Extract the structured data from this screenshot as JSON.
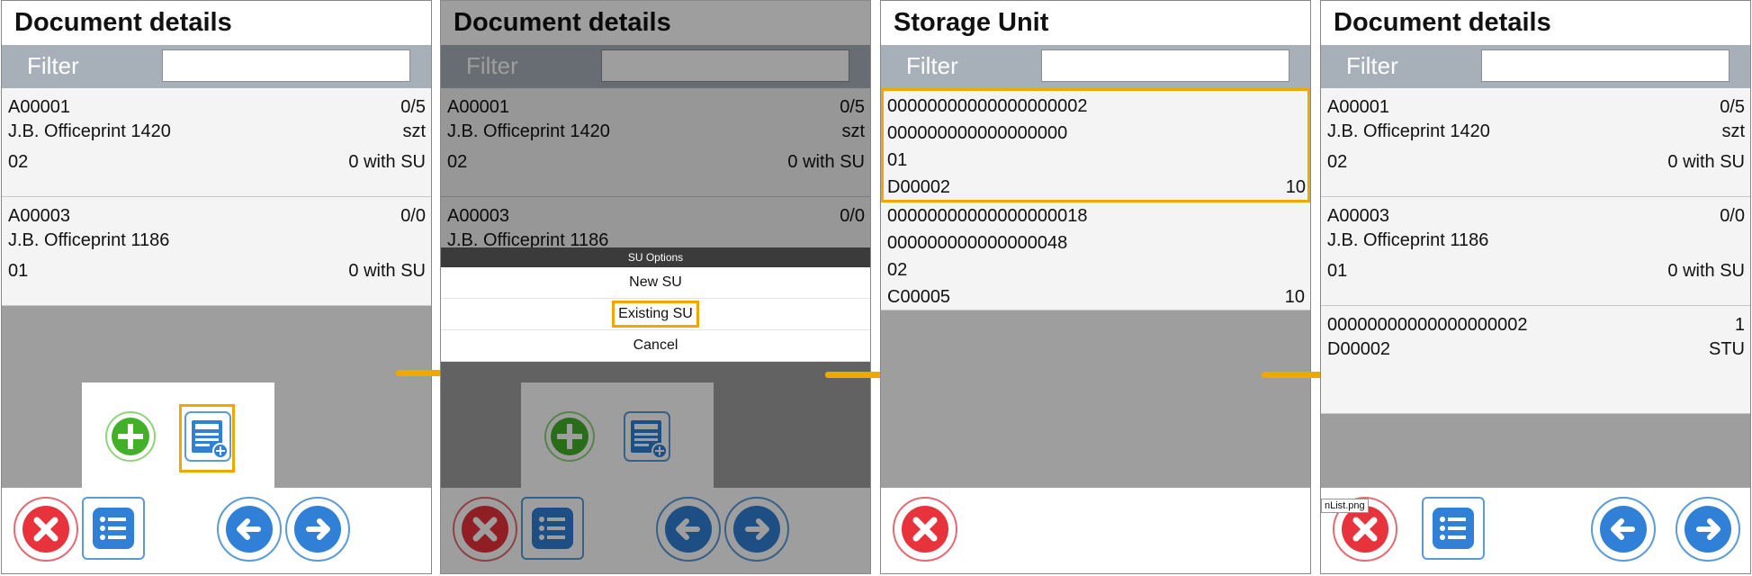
{
  "screens": [
    {
      "title": "Document details",
      "filter_label": "Filter",
      "items": [
        {
          "code": "A00001",
          "qty": "0/5",
          "name": "J.B. Officeprint 1420",
          "unit": "szt",
          "loc": "02",
          "su": "0 with SU"
        },
        {
          "code": "A00003",
          "qty": "0/0",
          "name": "J.B. Officeprint 1186",
          "unit": "",
          "loc": "01",
          "su": "0 with SU"
        }
      ]
    },
    {
      "title": "Document details",
      "filter_label": "Filter",
      "items": [
        {
          "code": "A00001",
          "qty": "0/5",
          "name": "J.B. Officeprint 1420",
          "unit": "szt",
          "loc": "02",
          "su": "0 with SU"
        },
        {
          "code": "A00003",
          "qty": "0/0",
          "name": "J.B. Officeprint 1186"
        }
      ],
      "menu": {
        "title": "SU Options",
        "items": [
          "New SU",
          "Existing SU",
          "Cancel"
        ]
      }
    },
    {
      "title": "Storage Unit",
      "filter_label": "Filter",
      "items": [
        {
          "l1": "00000000000000000002",
          "l2": "000000000000000000",
          "l3": "01",
          "l4": "D00002",
          "r4": "10"
        },
        {
          "l1": "00000000000000000018",
          "l2": "000000000000000048",
          "l3": "02",
          "l4": "C00005",
          "r4": "10"
        }
      ]
    },
    {
      "title": "Document details",
      "filter_label": "Filter",
      "items": [
        {
          "code": "A00001",
          "qty": "0/5",
          "name": "J.B. Officeprint 1420",
          "unit": "szt",
          "loc": "02",
          "su": "0 with SU"
        },
        {
          "code": "A00003",
          "qty": "0/0",
          "name": "J.B. Officeprint 1186",
          "unit": "",
          "loc": "01",
          "su": "0 with SU"
        }
      ],
      "su_entry": {
        "code": "00000000000000000002",
        "qty": "1",
        "doc": "D00002",
        "unit": "STU"
      },
      "tooltip": "nList.png"
    }
  ],
  "colors": {
    "highlight": "#f0a800",
    "arrow": "#f0a800",
    "red": "#e8323c",
    "blue": "#2f80d6",
    "green": "#43b02a"
  },
  "icons": [
    "cancel-icon",
    "list-icon",
    "back-arrow-icon",
    "forward-arrow-icon",
    "add-icon",
    "add-to-list-icon"
  ]
}
